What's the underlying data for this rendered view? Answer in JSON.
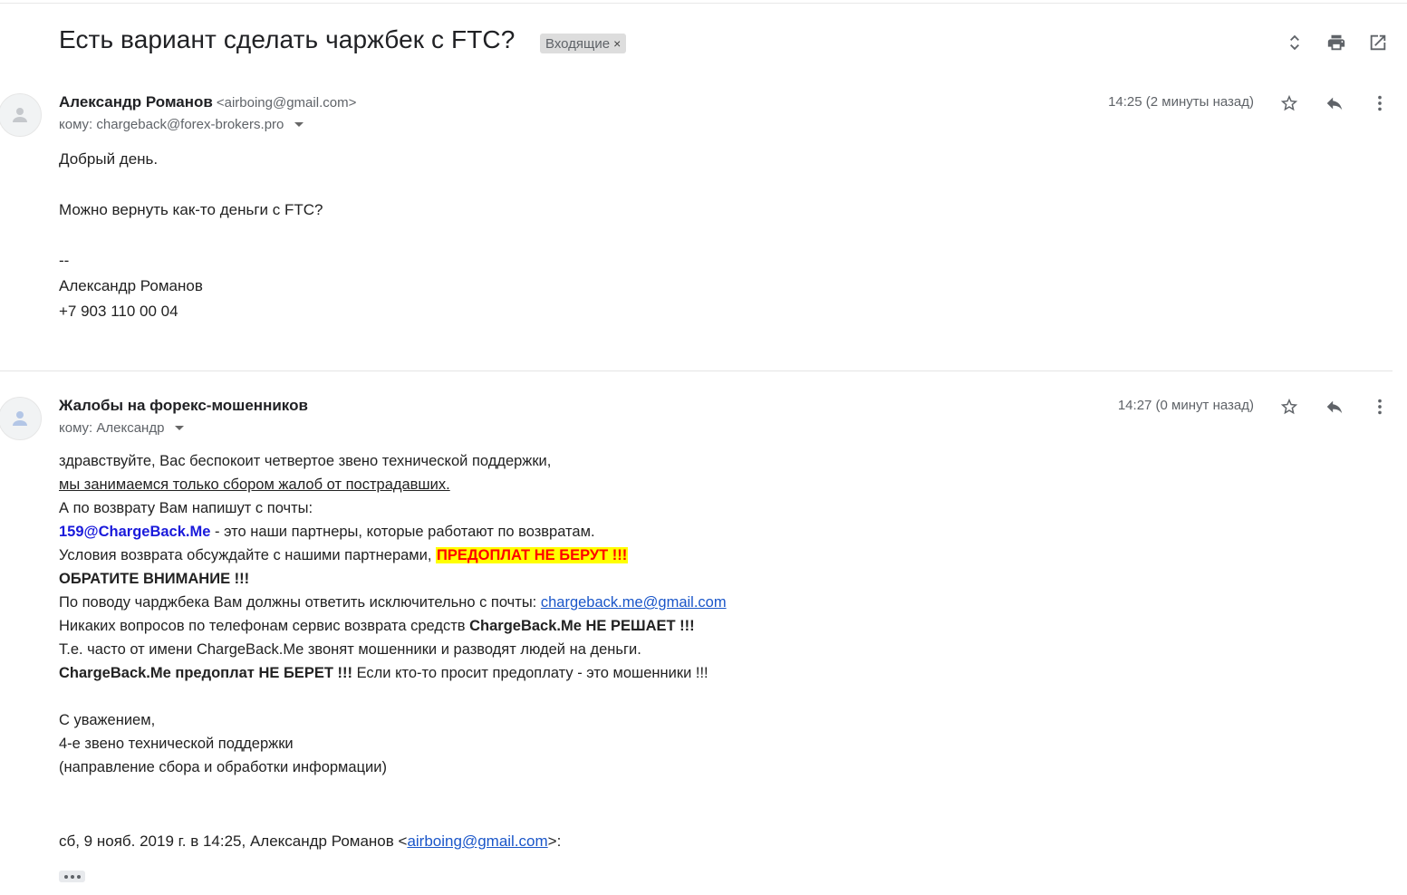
{
  "subject": "Есть вариант сделать чаржбек с FTC?",
  "label": {
    "text": "Входящие",
    "remove": "×"
  },
  "toolbar_icons": [
    "expand-collapse-icon",
    "print-icon",
    "open-in-new-window-icon"
  ],
  "message1": {
    "sender_name": "Александр Романов",
    "sender_email": "<airboing@gmail.com>",
    "to": "кому: chargeback@forex-brokers.pro",
    "time": "14:25 (2 минуты назад)",
    "lines": [
      "Добрый день.",
      "",
      "Можно вернуть как-то деньги с FTC?",
      "",
      "--",
      "Александр Романов",
      "+7 903 110 00 04"
    ]
  },
  "message2": {
    "sender_name": "Жалобы на форекс-мошенников",
    "to": "кому: Александр",
    "time": "14:27 (0 минут назад)",
    "l1": "здравствуйте, Вас беспокоит четвертое звено технической поддержки,",
    "l2": "мы занимаемся только сбором жалоб от пострадавших.",
    "l3": "А по возврату Вам напишут с почты:",
    "l4_email": "159@ChargeBack.Me",
    "l4_rest": " - это наши партнеры, которые работают по возвратам.",
    "l5_text": "Условия возврата обсуждайте с нашими партнерами, ",
    "l5_highlight": "ПРЕДОПЛАТ НЕ БЕРУТ !!!",
    "l6": "ОБРАТИТЕ ВНИМАНИЕ !!!",
    "l7_text": "По поводу чарджбека Вам должны ответить исключительно с почты: ",
    "l7_link": "chargeback.me@gmail.com",
    "l8_text": "Никаких вопросов по телефонам сервис возврата средств ",
    "l8_bold": "ChargeBack.Me НЕ РЕШАЕТ !!!",
    "l9": "Т.е. часто от имени ChargeBack.Me звонят мошенники и разводят людей на деньги.",
    "l10_bold": "ChargeBack.Me предоплат НЕ БЕРЕТ !!!",
    "l10_rest": " Если кто-то просит предоплату - это мошенники !!!",
    "sig1": "С уважением,",
    "sig2": "4-е звено технической поддержки",
    "sig3": "(направление сбора и обработки информации)",
    "quote_prefix": "сб, 9 нояб. 2019 г. в 14:25, Александр Романов <",
    "quote_email": "airboing@gmail.com",
    "quote_suffix": ">:"
  }
}
